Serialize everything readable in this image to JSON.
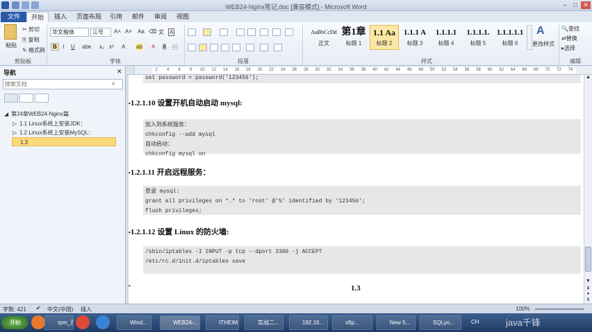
{
  "window": {
    "title": "WEB24-Nginx笔记.doc [兼容模式] - Microsoft Word"
  },
  "tabs": [
    "文件",
    "开始",
    "插入",
    "页面布局",
    "引用",
    "邮件",
    "审阅",
    "视图"
  ],
  "ribbon": {
    "clipboard": {
      "paste": "粘贴",
      "cut": "剪切",
      "copy": "复制",
      "format_painter": "格式刷",
      "group": "剪贴板"
    },
    "font": {
      "font_name": "华文楷体",
      "font_size": "三号",
      "group": "字体"
    },
    "paragraph": {
      "group": "段落"
    },
    "styles": {
      "group": "样式",
      "items": [
        {
          "preview": "AaBbCcDd",
          "name": "正文"
        },
        {
          "preview": "第1章",
          "name": "标题 1"
        },
        {
          "preview": "1.1 Aa",
          "name": "标题 2"
        },
        {
          "preview": "1.1.1 A",
          "name": "标题 3"
        },
        {
          "preview": "1.1.1.1",
          "name": "标题 4"
        },
        {
          "preview": "1.1.1.1.",
          "name": "标题 5"
        },
        {
          "preview": "1.1.1.1.1",
          "name": "标题 6"
        }
      ],
      "change_styles": "更改样式"
    },
    "editing": {
      "find": "查找",
      "replace": "替换",
      "select": "选择",
      "group": "编辑"
    }
  },
  "nav": {
    "title": "导航",
    "search_placeholder": "搜索文档",
    "items": [
      "第24章WEB24-Nginx篇",
      "1.1 Linux系统上安装JDK：",
      "1.2 Linux系统上安装MySQL:",
      "1.3"
    ]
  },
  "ruler_marks": [
    "2",
    "4",
    "6",
    "8",
    "10",
    "12",
    "14",
    "16",
    "18",
    "20",
    "22",
    "24",
    "26",
    "28",
    "30",
    "32",
    "34",
    "36",
    "38",
    "40",
    "42",
    "44",
    "46",
    "48",
    "50",
    "52",
    "54",
    "56",
    "58",
    "60",
    "62",
    "64",
    "66",
    "68",
    "70",
    "72",
    "74"
  ],
  "doc": {
    "line0": "set password = password('123456');",
    "h1": "1.2.1.10   设置开机自动启动 mysql:",
    "b1": [
      "加入到系统服务：",
      "chkconfig --add mysql",
      "自动启动：",
      "chkconfig mysql on"
    ],
    "h2": "1.2.1.11   开启远程服务：",
    "b2": [
      "登录 mysql:",
      "grant all privileges on *.* to 'root' @'%' identified by '123456';",
      "flush privileges;"
    ],
    "h3": "1.2.1.12   设置 Linux 的防火墙:",
    "b3": [
      "/sbin/iptables -I INPUT -p tcp --dport 3306 -j ACCEPT",
      "/etc/rc.d/init.d/iptables save",
      ""
    ],
    "h4": "1.3"
  },
  "status": {
    "words": "字数: 421",
    "lang": "中文(中国)",
    "mode": "插入",
    "zoom": "100%"
  },
  "taskbar": {
    "start": "开始",
    "items": [
      "rpm_百...",
      "Wind...",
      "WEB24-...",
      "ITHEIM...",
      "实战二...",
      "192.16...",
      "xftp...",
      "New 5...",
      "SQLyo..."
    ],
    "lang": "CH",
    "watermark": "java千锋"
  }
}
